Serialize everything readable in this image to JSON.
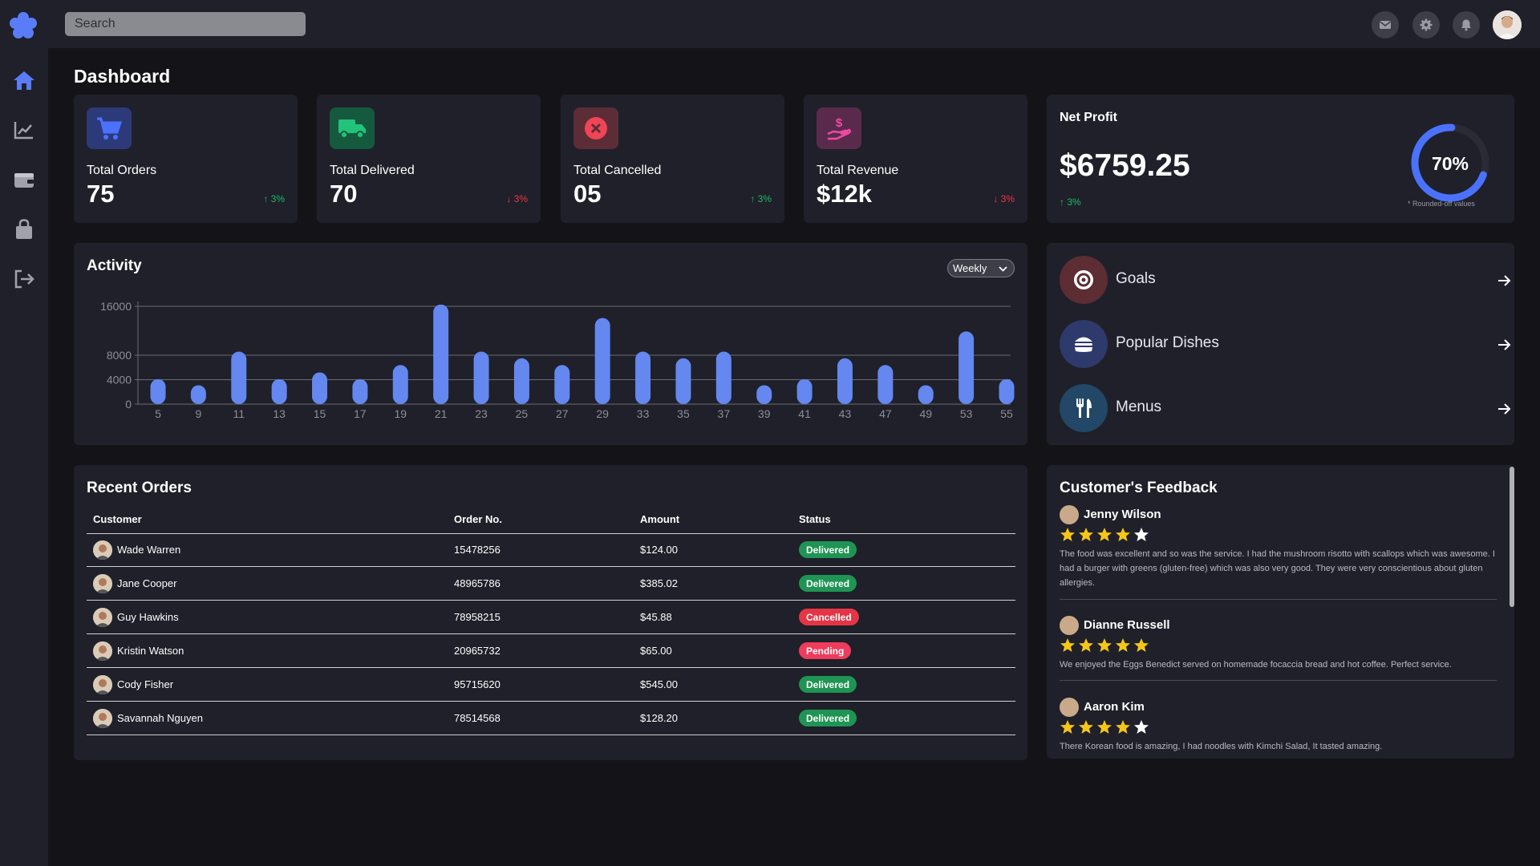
{
  "search": {
    "placeholder": "Search"
  },
  "page_title": "Dashboard",
  "stats": [
    {
      "label": "Total Orders",
      "value": "75",
      "change": "3%",
      "direction": "up",
      "icon": "cart-icon",
      "color": "#3b63f6"
    },
    {
      "label": "Total Delivered",
      "value": "70",
      "change": "3%",
      "direction": "down",
      "icon": "truck-icon",
      "color": "#18b96b"
    },
    {
      "label": "Total Cancelled",
      "value": "05",
      "change": "3%",
      "direction": "up",
      "icon": "cancel-icon",
      "color": "#ef3b4f"
    },
    {
      "label": "Total Revenue",
      "value": "$12k",
      "change": "3%",
      "direction": "down",
      "icon": "revenue-icon",
      "color": "#e23c94"
    }
  ],
  "net_profit": {
    "label": "Net Profit",
    "value": "$6759.25",
    "change": "3%",
    "percent": "70%",
    "progress": 0.7,
    "note": "* Rounded-off values"
  },
  "activity": {
    "title": "Activity",
    "period": "Weekly"
  },
  "chart_data": {
    "type": "bar",
    "title": "Activity",
    "categories": [
      "5",
      "9",
      "11",
      "13",
      "15",
      "17",
      "19",
      "21",
      "23",
      "25",
      "27",
      "29",
      "33",
      "35",
      "37",
      "39",
      "41",
      "43",
      "47",
      "49",
      "53",
      "55"
    ],
    "values": [
      3300,
      2300,
      7800,
      3300,
      4400,
      3300,
      5600,
      15500,
      7800,
      6700,
      5600,
      13300,
      7800,
      6700,
      7800,
      2300,
      3300,
      6700,
      5600,
      2300,
      11100,
      3300
    ],
    "yticks": [
      0,
      4000,
      8000,
      16000
    ],
    "ylim": [
      0,
      16000
    ],
    "color": "#6487f0",
    "grid": true
  },
  "quick_links": [
    {
      "label": "Goals",
      "icon": "target-icon",
      "color": "#5c2d33"
    },
    {
      "label": "Popular Dishes",
      "icon": "burger-icon",
      "color": "#2d3a6b"
    },
    {
      "label": "Menus",
      "icon": "utensils-icon",
      "color": "#234766"
    }
  ],
  "recent_orders": {
    "title": "Recent Orders",
    "columns": [
      "Customer",
      "Order No.",
      "Amount",
      "Status"
    ],
    "rows": [
      {
        "customer": "Wade Warren",
        "order_no": "15478256",
        "amount": "$124.00",
        "status": "Delivered"
      },
      {
        "customer": "Jane Cooper",
        "order_no": "48965786",
        "amount": "$385.02",
        "status": "Delivered"
      },
      {
        "customer": "Guy Hawkins",
        "order_no": "78958215",
        "amount": "$45.88",
        "status": "Cancelled"
      },
      {
        "customer": "Kristin Watson",
        "order_no": "20965732",
        "amount": "$65.00",
        "status": "Pending"
      },
      {
        "customer": "Cody Fisher",
        "order_no": "95715620",
        "amount": "$545.00",
        "status": "Delivered"
      },
      {
        "customer": "Savannah Nguyen",
        "order_no": "78514568",
        "amount": "$128.20",
        "status": "Delivered"
      }
    ]
  },
  "feedback": {
    "title": "Customer's Feedback",
    "items": [
      {
        "name": "Jenny Wilson",
        "rating": 4,
        "text": "The food was excellent and so was the service. I had the mushroom risotto with scallops which was awesome. I had a burger with greens (gluten-free) which was also very good. They were very conscientious about gluten allergies."
      },
      {
        "name": "Dianne Russell",
        "rating": 5,
        "text": "We enjoyed the Eggs Benedict served on homemade focaccia bread and hot coffee. Perfect service."
      },
      {
        "name": "Aaron Kim",
        "rating": 4,
        "text": "There Korean food is amazing, I had noodles with Kimchi Salad, It tasted amazing."
      }
    ]
  }
}
